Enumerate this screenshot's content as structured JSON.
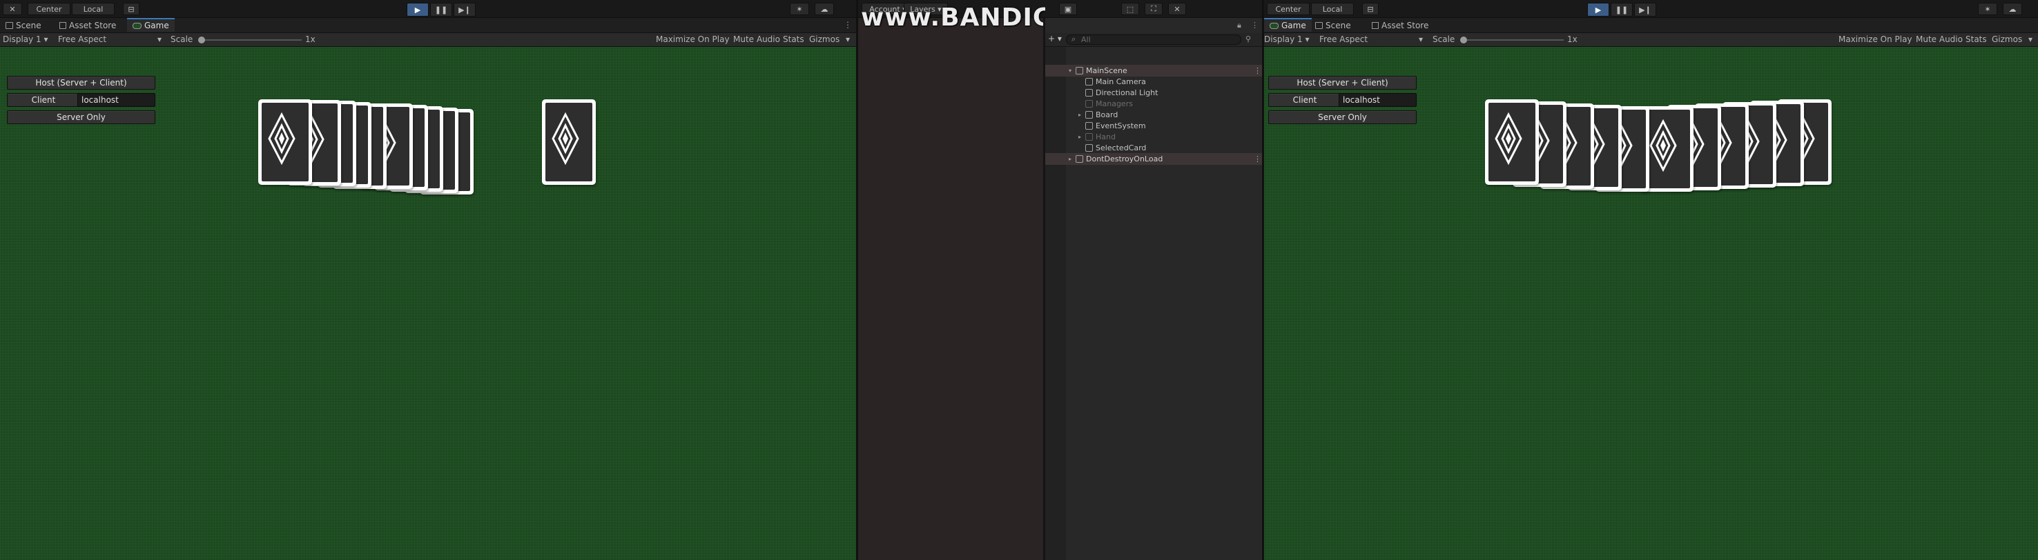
{
  "toolbar": {
    "pivot": "Center",
    "space": "Local",
    "account": "Account",
    "layers": "Layers"
  },
  "watermark": "www.BANDICAM.com",
  "left_window": {
    "tabs": [
      "Scene",
      "Asset Store",
      "Game"
    ],
    "display": "Display 1",
    "aspect": "Free Aspect",
    "scale_label": "Scale",
    "scale_value": "1x",
    "options": [
      "Maximize On Play",
      "Mute Audio",
      "Stats",
      "Gizmos"
    ]
  },
  "right_window": {
    "tabs": [
      "Game",
      "Scene",
      "Asset Store"
    ],
    "display": "Display 1",
    "aspect": "Free Aspect",
    "scale_label": "Scale",
    "scale_value": "1x",
    "options": [
      "Maximize On Play",
      "Mute Audio",
      "Stats",
      "Gizmos"
    ]
  },
  "network_ui": {
    "host_button": "Host (Server + Client)",
    "client_button": "Client",
    "address_value": "localhost",
    "server_button": "Server Only"
  },
  "hierarchy": {
    "search_placeholder": "All",
    "items": [
      {
        "label": "MainScene",
        "state": "scene"
      },
      {
        "label": "Main Camera",
        "state": "active"
      },
      {
        "label": "Directional Light",
        "state": "active"
      },
      {
        "label": "Managers",
        "state": "inactive"
      },
      {
        "label": "Board",
        "state": "active"
      },
      {
        "label": "EventSystem",
        "state": "active"
      },
      {
        "label": "Hand",
        "state": "inactive"
      },
      {
        "label": "SelectedCard",
        "state": "active"
      },
      {
        "label": "DontDestroyOnLoad",
        "state": "scene"
      }
    ]
  },
  "colors": {
    "game_background": "#1c4a1f",
    "play_active": "#3b5c86",
    "card_face": "#2e2e2e"
  },
  "icons": [
    "tools-icon",
    "play-icon",
    "pause-icon",
    "step-icon",
    "cloud-icon",
    "settings-icon",
    "lock-icon",
    "add-icon",
    "search-icon",
    "cube-icon"
  ]
}
